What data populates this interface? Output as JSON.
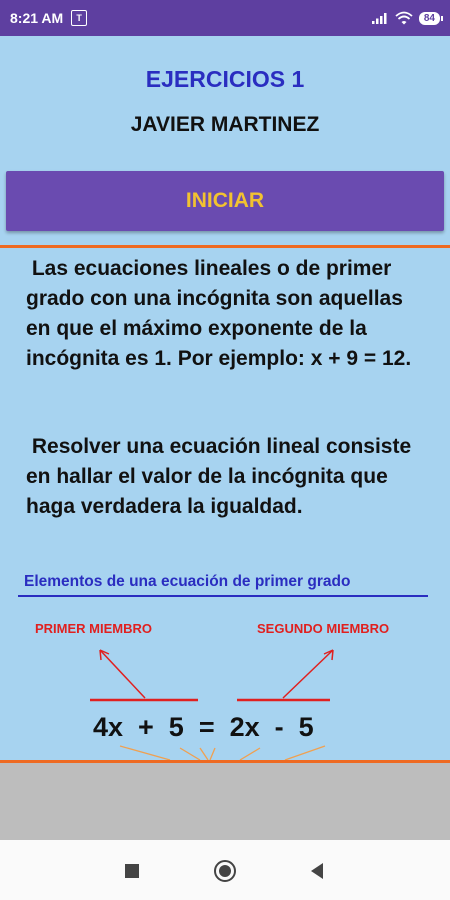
{
  "status_bar": {
    "time": "8:21 AM",
    "notification_icon_label": "T",
    "battery_level": "84",
    "icons": [
      "notification-icon",
      "signal-icon",
      "wifi-icon",
      "battery-icon"
    ]
  },
  "header": {
    "title": "EJERCICIOS 1",
    "author": "JAVIER MARTINEZ"
  },
  "start_button": {
    "label": "INICIAR"
  },
  "content": {
    "paragraph1": " Las ecuaciones lineales o de primer grado con una incógnita son aquellas en que el máximo exponente de la incógnita es 1. Por ejemplo: x + 9 = 12.",
    "paragraph2": " Resolver una ecuación lineal consiste en hallar el valor de la incógnita que haga verdadera la igualdad.",
    "elements_title": "Elementos de una ecuación de primer grado"
  },
  "diagram": {
    "first_member_label": "PRIMER MIEMBRO",
    "second_member_label": "SEGUNDO MIEMBRO",
    "equation": "4x  +  5  =  2x  -  5"
  },
  "colors": {
    "status_bar": "#5e3fa0",
    "background": "#a7d3f0",
    "button_bg": "#6a4bb0",
    "button_text": "#f2c230",
    "title": "#2a2dc0",
    "divider": "#ee6a22",
    "member_label": "#e0201f"
  },
  "nav_bar": {
    "icons": [
      "recents-square-icon",
      "home-circle-icon",
      "back-triangle-icon"
    ]
  }
}
